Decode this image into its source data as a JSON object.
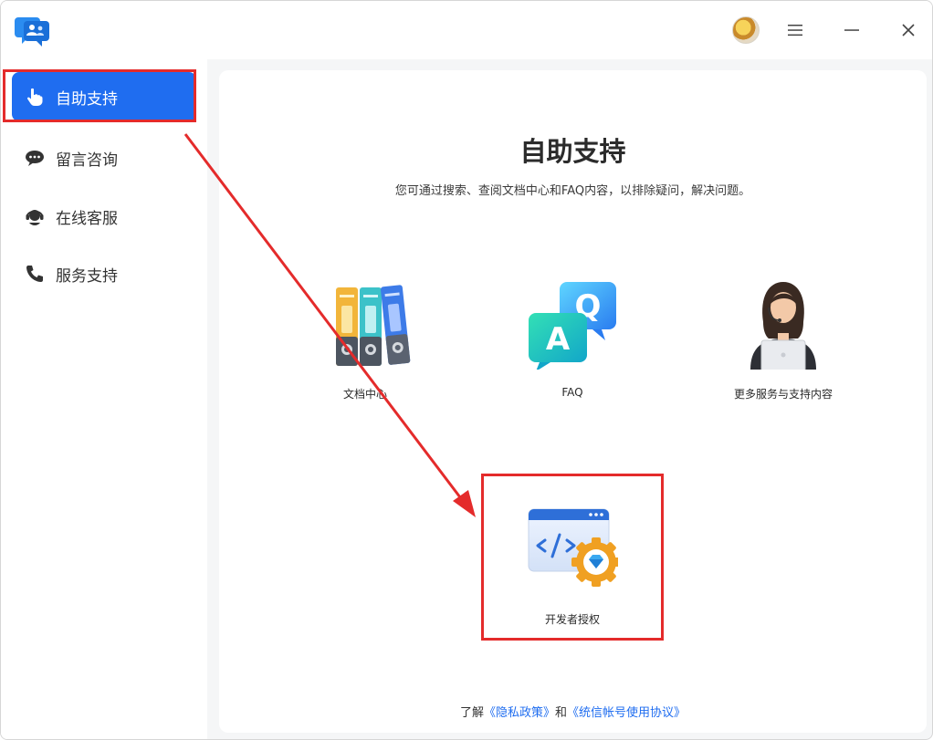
{
  "window": {
    "menu_icon": "hamburger-icon",
    "minimize_icon": "minimize-icon",
    "close_icon": "close-icon"
  },
  "sidebar": {
    "items": [
      {
        "label": "自助支持",
        "icon": "pointer-hand-icon",
        "active": true
      },
      {
        "label": "留言咨询",
        "icon": "chat-bubble-icon",
        "active": false
      },
      {
        "label": "在线客服",
        "icon": "headset-icon",
        "active": false
      },
      {
        "label": "服务支持",
        "icon": "phone-icon",
        "active": false
      }
    ]
  },
  "main": {
    "title": "自助支持",
    "subtitle": "您可通过搜索、查阅文档中心和FAQ内容，以排除疑问，解决问题。",
    "cards": [
      {
        "label": "文档中心",
        "icon": "document-binders-icon"
      },
      {
        "label": "FAQ",
        "icon": "faq-qa-icon"
      },
      {
        "label": "更多服务与支持内容",
        "icon": "support-agent-icon"
      },
      {
        "label": "开发者授权",
        "icon": "developer-code-gear-icon"
      }
    ],
    "footer": {
      "prefix": "了解",
      "privacy_link": "《隐私政策》",
      "conjunction": "和",
      "agreement_link": "《统信帐号使用协议》"
    }
  },
  "colors": {
    "accent": "#1f6df0",
    "annotation": "#e42b2b"
  }
}
